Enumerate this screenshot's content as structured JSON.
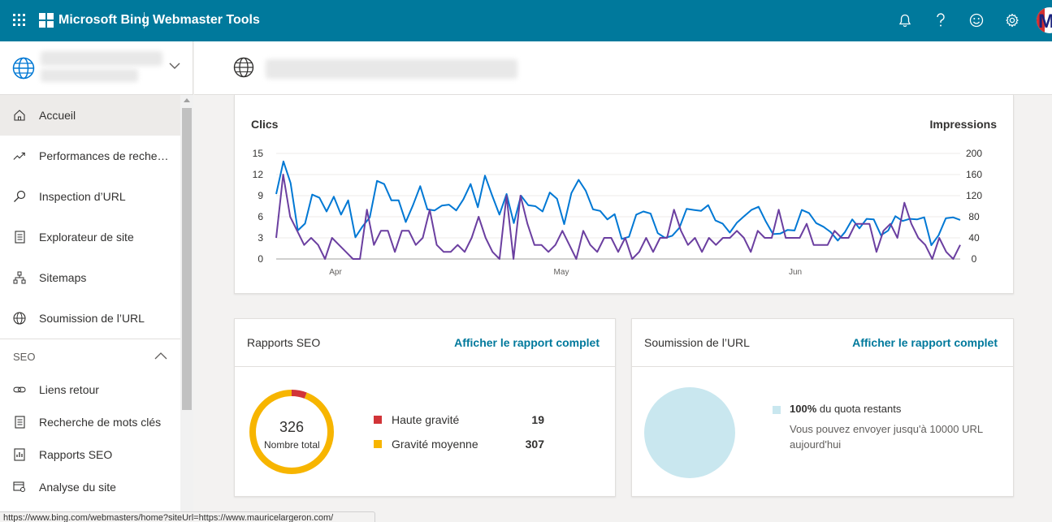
{
  "topbar": {
    "brand": "Microsoft Bing",
    "product": "Webmaster Tools",
    "icons": [
      "waffle-icon",
      "bell-icon",
      "help-icon",
      "smiley-icon",
      "gear-icon"
    ]
  },
  "sidebar": {
    "items": [
      {
        "label": "Accueil",
        "icon": "home-icon"
      },
      {
        "label": "Performances de recher…",
        "icon": "trend-icon"
      },
      {
        "label": "Inspection d’URL",
        "icon": "search-icon"
      },
      {
        "label": "Explorateur de site",
        "icon": "document-icon"
      },
      {
        "label": "Sitemaps",
        "icon": "sitemap-icon"
      },
      {
        "label": "Soumission de l’URL",
        "icon": "globe-icon"
      }
    ],
    "seo_section": "SEO",
    "seo_items": [
      {
        "label": "Liens retour",
        "icon": "link-icon"
      },
      {
        "label": "Recherche de mots clés",
        "icon": "document-icon"
      },
      {
        "label": "Rapports SEO",
        "icon": "report-icon"
      },
      {
        "label": "Analyse du site",
        "icon": "scan-icon"
      }
    ]
  },
  "chart_data": {
    "type": "line",
    "left_axis_title": "Clics",
    "right_axis_title": "Impressions",
    "left_ticks": [
      "15",
      "12",
      "9",
      "6",
      "3",
      "0"
    ],
    "right_ticks": [
      "200",
      "160",
      "120",
      "80",
      "40",
      "0"
    ],
    "x_ticks": [
      "Apr",
      "May",
      "Jun"
    ],
    "ylim_left": [
      0,
      15
    ],
    "ylim_right": [
      0,
      200
    ],
    "series": [
      {
        "axis": "right",
        "color": "#0078d4",
        "values": [
          123,
          185,
          144,
          54,
          67,
          122,
          116,
          90,
          118,
          84,
          111,
          41,
          62,
          79,
          148,
          142,
          111,
          111,
          70,
          102,
          138,
          94,
          92,
          101,
          103,
          92,
          113,
          142,
          98,
          158,
          120,
          84,
          123,
          68,
          120,
          102,
          100,
          90,
          126,
          114,
          66,
          125,
          150,
          129,
          94,
          91,
          75,
          85,
          38,
          42,
          84,
          90,
          86,
          49,
          40,
          44,
          59,
          95,
          93,
          91,
          102,
          73,
          67,
          50,
          69,
          81,
          93,
          99,
          71,
          47,
          48,
          55,
          54,
          93,
          87,
          68,
          61,
          51,
          35,
          51,
          75,
          58,
          76,
          75,
          45,
          54,
          81,
          72,
          76,
          75,
          79,
          26,
          45,
          77,
          79,
          74
        ]
      },
      {
        "axis": "left",
        "color": "#6b3fa0",
        "values": [
          3,
          12,
          6,
          4,
          2,
          3,
          2,
          0,
          3,
          2,
          1,
          0,
          0,
          7,
          2,
          4,
          4,
          1,
          4,
          4,
          2,
          3,
          7,
          2,
          1,
          1,
          2,
          1,
          3,
          6,
          3,
          1,
          0,
          9,
          0,
          9,
          5,
          2,
          2,
          1,
          2,
          4,
          2,
          0,
          4,
          2,
          1,
          3,
          3,
          1,
          3,
          0,
          1,
          3,
          1,
          3,
          3,
          7,
          4,
          2,
          3,
          1,
          3,
          2,
          3,
          3,
          4,
          3,
          1,
          4,
          3,
          3,
          7,
          3,
          3,
          3,
          5,
          2,
          2,
          2,
          4,
          3,
          3,
          5,
          5,
          5,
          1,
          4,
          5,
          3,
          8,
          5,
          3,
          2,
          0,
          3,
          1,
          0,
          2
        ]
      }
    ]
  },
  "seo_report": {
    "title": "Rapports SEO",
    "link": "Afficher le rapport complet",
    "total": "326",
    "total_label": "Nombre total",
    "legend": [
      {
        "label": "Haute gravité",
        "value": "19",
        "color": "#d13438"
      },
      {
        "label": "Gravité moyenne",
        "value": "307",
        "color": "#f7b500"
      }
    ],
    "high": 19,
    "medium": 307
  },
  "url_submission": {
    "title": "Soumission de l’URL",
    "link": "Afficher le rapport complet",
    "quota_percent": "100%",
    "quota_text": "du quota restants",
    "quota_sub": "Vous pouvez envoyer jusqu'à 10000 URL aujourd'hui"
  },
  "statusbar": {
    "url": "https://www.bing.com/webmasters/home?siteUrl=https://www.mauricelargeron.com/"
  },
  "colors": {
    "topbar": "#00799c",
    "link": "#00799c",
    "impressions": "#0078d4",
    "clicks": "#6b3fa0"
  }
}
